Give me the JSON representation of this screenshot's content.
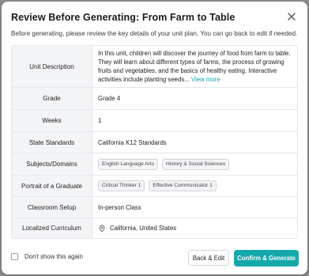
{
  "modal": {
    "title": "Review Before Generating: From Farm to Table",
    "subtitle": "Before generating, please review the key details of your unit plan. You can go back to edit if needed."
  },
  "details": {
    "unit_description": {
      "label": "Unit Description",
      "text": "In this unit, children will discover the journey of food from farm to table. They will learn about different types of farms, the process of growing fruits and vegetables, and the basics of healthy eating. Interactive activities include planting seeds...",
      "link": "View more"
    },
    "grade": {
      "label": "Grade",
      "value": "Grade 4"
    },
    "weeks": {
      "label": "Weeks",
      "value": "1"
    },
    "state_standards": {
      "label": "State Standards",
      "value": "California K12 Standards"
    },
    "subjects": {
      "label": "Subjects/Domains",
      "chips": [
        "English Language Arts",
        "History & Social Sciences"
      ]
    },
    "portrait": {
      "label": "Portrait of a Graduate",
      "chips": [
        "Critical Thinker 1",
        "Effective Communicator 1"
      ]
    },
    "classroom_setup": {
      "label": "Classroom Setup",
      "value": "In-person Class"
    },
    "localized_curriculum": {
      "label": "Localized Curriculum",
      "value": "California, United States",
      "icon": "location-pin-icon"
    }
  },
  "footer": {
    "checkbox_label": "Don't show this again",
    "checkbox_checked": false,
    "back_label": "Back & Edit",
    "confirm_label": "Confirm & Generate"
  },
  "colors": {
    "accent": "#14a8ab",
    "overlay": "#8e8e8e",
    "label_bg": "#f3f4f6"
  }
}
